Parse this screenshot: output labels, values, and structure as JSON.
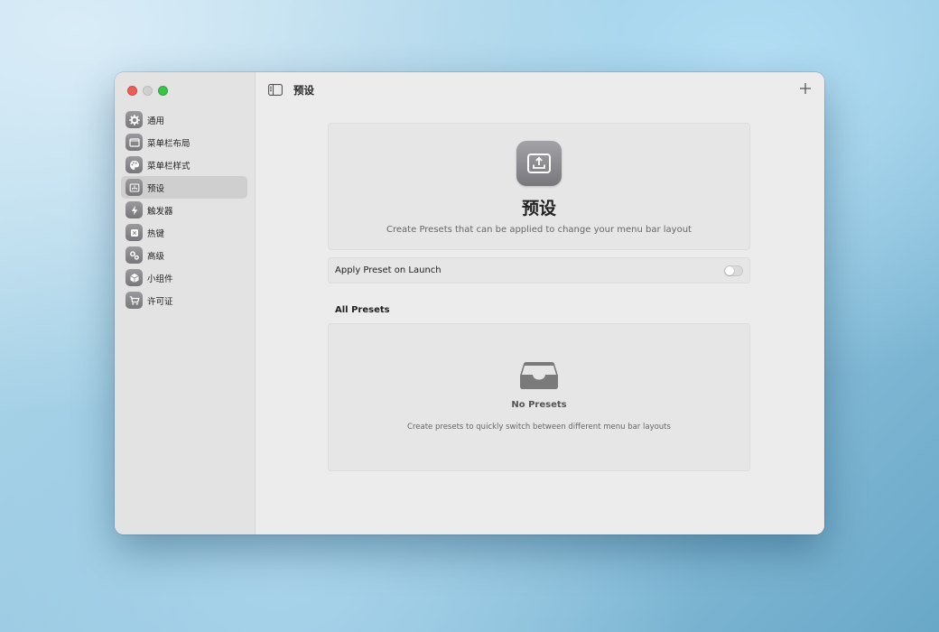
{
  "window": {
    "controls": [
      "close",
      "minimize",
      "zoom"
    ]
  },
  "sidebar": {
    "items": [
      {
        "label": "通用",
        "icon": "gear-icon"
      },
      {
        "label": "菜单栏布局",
        "icon": "menubar-layout-icon"
      },
      {
        "label": "菜单栏样式",
        "icon": "palette-icon"
      },
      {
        "label": "预设",
        "icon": "presets-icon",
        "active": true
      },
      {
        "label": "触发器",
        "icon": "bolt-icon"
      },
      {
        "label": "热键",
        "icon": "keyboard-icon"
      },
      {
        "label": "高级",
        "icon": "gears-icon"
      },
      {
        "label": "小组件",
        "icon": "cube-icon"
      },
      {
        "label": "许可证",
        "icon": "cart-icon"
      }
    ]
  },
  "toolbar": {
    "title": "预设",
    "add_icon": "plus-icon",
    "sidebar_toggle_icon": "sidebar-toggle-icon"
  },
  "hero": {
    "icon": "upload-tray-icon",
    "title": "预设",
    "subtitle": "Create Presets that can be applied to change your menu bar layout"
  },
  "settings": {
    "apply_on_launch": {
      "label": "Apply Preset on Launch",
      "enabled": false
    }
  },
  "presets": {
    "section_title": "All Presets",
    "empty_icon": "inbox-icon",
    "empty_title": "No Presets",
    "empty_subtitle": "Create presets to quickly switch between different menu bar layouts"
  },
  "colors": {
    "close": "#ee5e57",
    "minimize": "#cfcfcf",
    "zoom": "#39c448",
    "icon_gray": "#808084"
  }
}
